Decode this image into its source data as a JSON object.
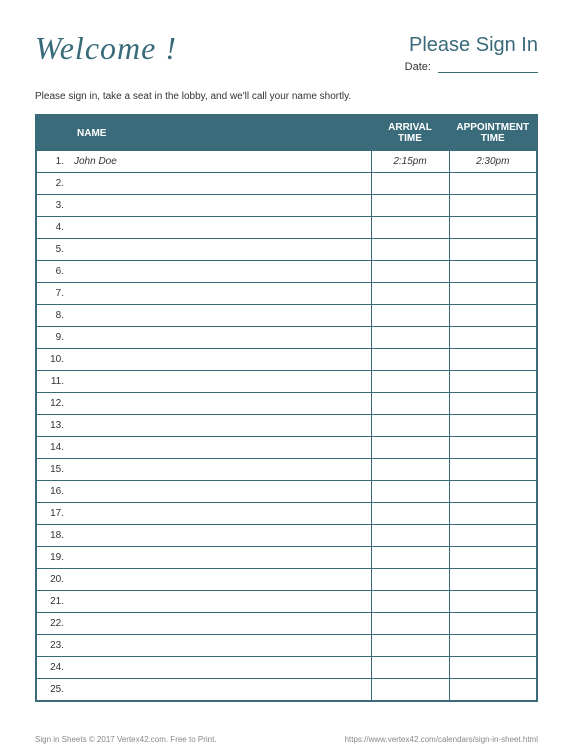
{
  "header": {
    "welcome": "Welcome !",
    "please_sign_in": "Please Sign In",
    "date_label": "Date:",
    "date_value": ""
  },
  "instruction": "Please sign in, take a seat in the lobby, and we'll call your name shortly.",
  "columns": {
    "name": "NAME",
    "arrival": "ARRIVAL TIME",
    "appointment": "APPOINTMENT TIME"
  },
  "rows": [
    {
      "n": "1.",
      "name": "John Doe",
      "arrival": "2:15pm",
      "appointment": "2:30pm"
    },
    {
      "n": "2.",
      "name": "",
      "arrival": "",
      "appointment": ""
    },
    {
      "n": "3.",
      "name": "",
      "arrival": "",
      "appointment": ""
    },
    {
      "n": "4.",
      "name": "",
      "arrival": "",
      "appointment": ""
    },
    {
      "n": "5.",
      "name": "",
      "arrival": "",
      "appointment": ""
    },
    {
      "n": "6.",
      "name": "",
      "arrival": "",
      "appointment": ""
    },
    {
      "n": "7.",
      "name": "",
      "arrival": "",
      "appointment": ""
    },
    {
      "n": "8.",
      "name": "",
      "arrival": "",
      "appointment": ""
    },
    {
      "n": "9.",
      "name": "",
      "arrival": "",
      "appointment": ""
    },
    {
      "n": "10.",
      "name": "",
      "arrival": "",
      "appointment": ""
    },
    {
      "n": "11.",
      "name": "",
      "arrival": "",
      "appointment": ""
    },
    {
      "n": "12.",
      "name": "",
      "arrival": "",
      "appointment": ""
    },
    {
      "n": "13.",
      "name": "",
      "arrival": "",
      "appointment": ""
    },
    {
      "n": "14.",
      "name": "",
      "arrival": "",
      "appointment": ""
    },
    {
      "n": "15.",
      "name": "",
      "arrival": "",
      "appointment": ""
    },
    {
      "n": "16.",
      "name": "",
      "arrival": "",
      "appointment": ""
    },
    {
      "n": "17.",
      "name": "",
      "arrival": "",
      "appointment": ""
    },
    {
      "n": "18.",
      "name": "",
      "arrival": "",
      "appointment": ""
    },
    {
      "n": "19.",
      "name": "",
      "arrival": "",
      "appointment": ""
    },
    {
      "n": "20.",
      "name": "",
      "arrival": "",
      "appointment": ""
    },
    {
      "n": "21.",
      "name": "",
      "arrival": "",
      "appointment": ""
    },
    {
      "n": "22.",
      "name": "",
      "arrival": "",
      "appointment": ""
    },
    {
      "n": "23.",
      "name": "",
      "arrival": "",
      "appointment": ""
    },
    {
      "n": "24.",
      "name": "",
      "arrival": "",
      "appointment": ""
    },
    {
      "n": "25.",
      "name": "",
      "arrival": "",
      "appointment": ""
    }
  ],
  "footer": {
    "left": "Sign in Sheets © 2017 Vertex42.com. Free to Print.",
    "right": "https://www.vertex42.com/calendars/sign-in-sheet.html"
  }
}
